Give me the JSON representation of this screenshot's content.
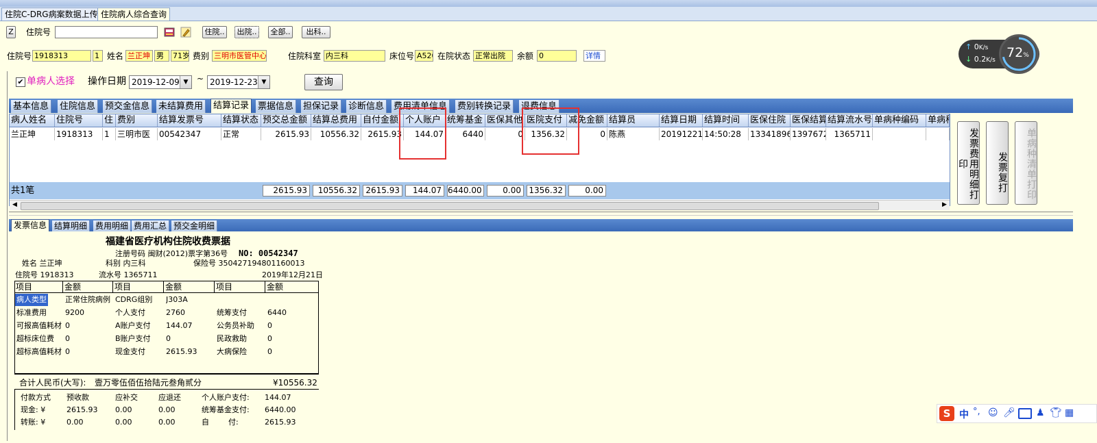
{
  "window_tabs": [
    "住院C-DRG病案数据上传",
    "住院病人综合查询"
  ],
  "search": {
    "z_label": "Z",
    "hospital_no_label": "住院号",
    "hospital_no_value": "",
    "btn_inpatient": "住院..",
    "btn_discharged": "出院..",
    "btn_all": "全部..",
    "btn_dept": "出科.."
  },
  "patient": {
    "no_label": "住院号",
    "no": "1918313",
    "times": "1",
    "name_label": "姓名",
    "name": "兰正坤",
    "sex": "男",
    "age": "71岁",
    "fee_label": "费别",
    "fee": "三明市医管中心",
    "dept_label": "住院科室",
    "dept": "内三科",
    "bed_label": "床位号",
    "bed": "A520",
    "status_label": "在院状态",
    "status": "正常出院",
    "balance_label": "余额",
    "balance": "0",
    "detail_link": "详情"
  },
  "filter": {
    "single_patient": "单病人选择",
    "op_date_label": "操作日期",
    "date_from": "2019-12-09",
    "tilde": "~",
    "date_to": "2019-12-23",
    "query_btn": "查询"
  },
  "tabs": [
    "基本信息",
    "住院信息",
    "预交金信息",
    "未结算费用",
    "结算记录",
    "票据信息",
    "担保记录",
    "诊断信息",
    "费用清单信息",
    "费别转换记录",
    "退费信息"
  ],
  "grid": {
    "headers": [
      "病人姓名",
      "住院号",
      "住",
      "费别",
      "结算发票号",
      "结算状态",
      "预交总金额",
      "结算总费用",
      "自付金额",
      "个人账户",
      "统筹基金",
      "医保其他",
      "医院支付",
      "减免金额",
      "结算员",
      "结算日期",
      "结算时间",
      "医保住院",
      "医保结算",
      "结算流水号",
      "单病种编码",
      "单病种"
    ],
    "row": [
      "兰正坤",
      "1918313",
      "1",
      "三明市医",
      "00542347",
      "正常",
      "2615.93",
      "10556.32",
      "2615.93",
      "144.07",
      "6440",
      "0",
      "1356.32",
      "0",
      "陈燕",
      "20191221",
      "14:50:28",
      "13341896",
      "1397672",
      "1365711",
      "",
      ""
    ],
    "total_label": "共1笔",
    "totals": [
      "2615.93",
      "10556.32",
      "2615.93",
      "144.07",
      "6440.00",
      "0.00",
      "1356.32",
      "0.00"
    ]
  },
  "side_buttons": [
    "发票费用明细打印",
    "发票复打",
    "单病种清单打印"
  ],
  "lower_tabs": [
    "发票信息",
    "结算明细",
    "费用明细",
    "费用汇总",
    "预交金明细"
  ],
  "receipt": {
    "title": "福建省医疗机构住院收费票据",
    "reg_label": "注册号码 闽财(2012)票字第36号",
    "no_label": "NO: 00542347",
    "name_line": "姓名 兰正坤",
    "dept_line": "科别 内三科",
    "ins_line": "保险号 350427194801160013",
    "hosp_line": "住院号 1918313",
    "serial_line": "流水号 1365711",
    "date_line": "2019年12月21日",
    "table_headers": [
      "项目",
      "金额",
      "项目",
      "金额",
      "项目",
      "金额"
    ],
    "rows": [
      [
        "病人类型",
        "正常住院病例",
        "CDRG组别",
        "J303A",
        "",
        ""
      ],
      [
        "标准费用",
        "9200",
        "个人支付",
        "2760",
        "统筹支付",
        "6440"
      ],
      [
        "可报高值耗材",
        "0",
        "A账户支付",
        "144.07",
        "公务员补助",
        "0"
      ],
      [
        "超标床位费",
        "0",
        "B账户支付",
        "0",
        "民政救助",
        "0"
      ],
      [
        "超标高值耗材",
        "0",
        "现金支付",
        "2615.93",
        "大病保险",
        "0"
      ]
    ],
    "total_label": "合计人民币(大写):",
    "total_words": "壹万零伍佰伍拾陆元叁角贰分",
    "total_amount": "¥10556.32",
    "pay": {
      "headers": [
        "付款方式",
        "预收款",
        "应补交",
        "应退还"
      ],
      "cash": [
        "现金: ¥",
        "2615.93",
        "0.00",
        "0.00"
      ],
      "transfer": [
        "转账: ¥",
        "0.00",
        "0.00",
        "0.00"
      ],
      "personal_label": "个人账户支付:",
      "personal": "144.07",
      "pool_label": "统筹基金支付:",
      "pool": "6440.00",
      "self_label": "自        付:",
      "self": "2615.93"
    }
  },
  "net_widget": {
    "up": "0",
    "up_unit": "K/s",
    "down": "0.2",
    "down_unit": "K/s",
    "percent": "72",
    "percent_unit": "%"
  },
  "ime_bar": {
    "logo": "S",
    "mode": "中",
    "punct": "°,"
  }
}
